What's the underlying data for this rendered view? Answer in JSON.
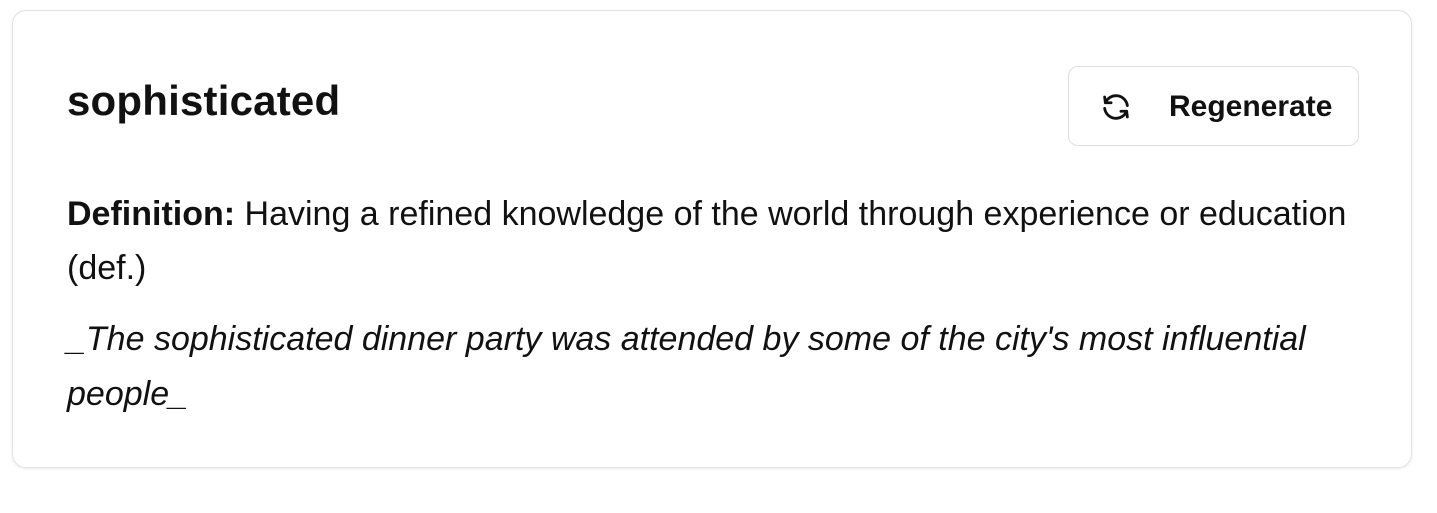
{
  "card": {
    "word": "sophisticated",
    "regenerate_button": {
      "label": "Regenerate",
      "icon": "refresh-icon"
    },
    "definition": {
      "label": "Definition:",
      "text": " Having a refined knowledge of the world through experience or education (def.)"
    },
    "example": "_The sophisticated dinner party was attended by some of the city's most influential people_"
  },
  "colors": {
    "text": "#111111",
    "border": "#e2e2e2",
    "background": "#ffffff"
  }
}
